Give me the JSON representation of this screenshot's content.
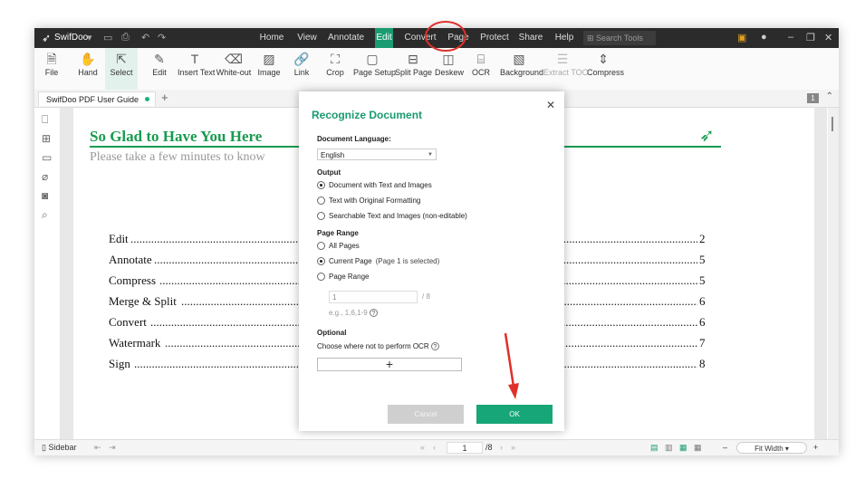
{
  "app": {
    "name": "SwifDoo",
    "search_placeholder": "Search Tools"
  },
  "menu": [
    "Home",
    "View",
    "Annotate",
    "Edit",
    "Convert",
    "Page",
    "Protect",
    "Share",
    "Help"
  ],
  "ribbon": [
    "File",
    "Hand",
    "Select",
    "Edit",
    "Insert Text",
    "White-out",
    "Image",
    "Link",
    "Crop",
    "Page Setup",
    "Split Page",
    "Deskew",
    "OCR",
    "Background",
    "Extract TOC",
    "Compress"
  ],
  "tab": {
    "name": "SwifDoo PDF User Guide",
    "page_badge": "1"
  },
  "document": {
    "heading": "So Glad to Have You Here",
    "subtitle": "Please take a few minutes to know",
    "toc": [
      {
        "label": "Edit",
        "page": "2"
      },
      {
        "label": "Annotate",
        "page": "5"
      },
      {
        "label": "Compress",
        "page": "5"
      },
      {
        "label": "Merge & Split",
        "page": "6"
      },
      {
        "label": "Convert",
        "page": "6"
      },
      {
        "label": "Watermark",
        "page": "7"
      },
      {
        "label": "Sign",
        "page": "8"
      }
    ]
  },
  "status": {
    "sidebar": "Sidebar",
    "page": "1",
    "total": "/8",
    "zoom": "Fit Width"
  },
  "dialog": {
    "title": "Recognize Document",
    "language_label": "Document Language:",
    "language_value": "English",
    "output_label": "Output",
    "output_options": [
      "Document with Text and Images",
      "Text with Original Formatting",
      "Searchable Text and Images (non-editable)"
    ],
    "range_label": "Page Range",
    "range_all": "All Pages",
    "range_current": "Current Page",
    "range_current_hint": "(Page 1 is selected)",
    "range_custom": "Page Range",
    "range_input": "1",
    "range_of": "/ 8",
    "range_example": "e.g., 1,6,1-9",
    "optional_label": "Optional",
    "optional_text": "Choose where not to perform OCR",
    "add": "+",
    "cancel": "Cancel",
    "ok": "OK"
  },
  "colors": {
    "accent": "#1a9b72",
    "highlight": "#e0302a"
  }
}
